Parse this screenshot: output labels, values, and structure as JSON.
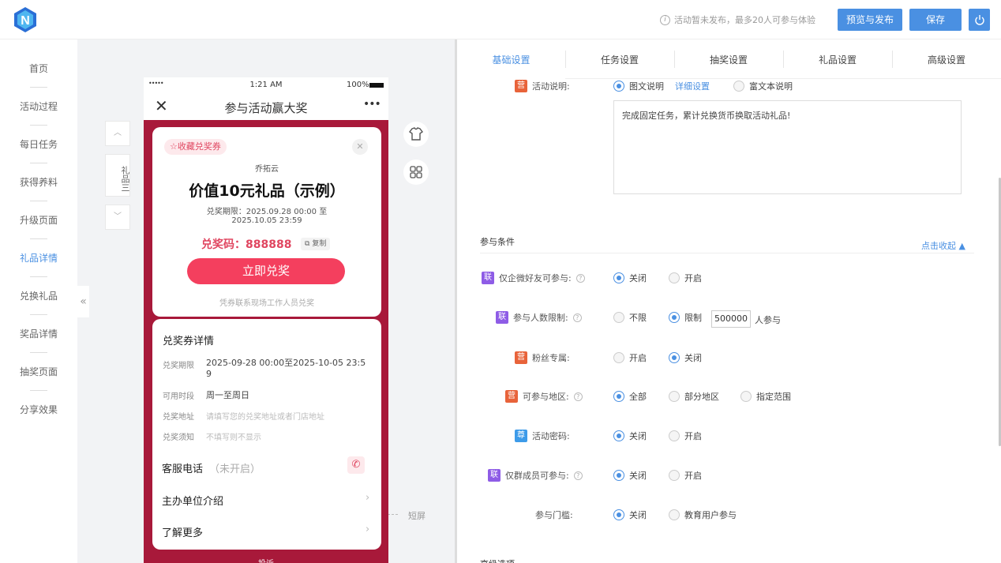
{
  "header": {
    "notice": "活动暂未发布，最多20人可参与体验",
    "preview_button": "预览与发布",
    "save_button": "保存"
  },
  "left_nav": {
    "items": [
      "首页",
      "活动过程",
      "每日任务",
      "获得养料",
      "升级页面",
      "礼品详情",
      "兑换礼品",
      "奖品详情",
      "抽奖页面",
      "分享效果"
    ],
    "active": "礼品详情"
  },
  "canvas": {
    "side_label": "礼品三",
    "short_screen": "短屏"
  },
  "phone": {
    "status_dots": "•••••",
    "status_time": "1:21 AM",
    "status_battery": "100%",
    "title": "参与活动赢大奖",
    "more": "•••",
    "voucher": {
      "collect_label": "收藏兑奖券",
      "brand": "乔拓云",
      "title": "价值10元礼品（示例）",
      "validity_line1": "兑奖期限：2025.09.28 00:00 至",
      "validity_line2": "2025.10.05 23:59",
      "code_label": "兑奖码：888888",
      "copy": "复制",
      "redeem_button": "立即兑奖",
      "hint": "凭券联系现场工作人员兑奖"
    },
    "details": {
      "title": "兑奖券详情",
      "rows": [
        {
          "key": "兑奖期限",
          "value": "2025-09-28 00:00至2025-10-05 23:59"
        },
        {
          "key": "可用时段",
          "value": "周一至周日"
        },
        {
          "key": "兑奖地址",
          "value": "请填写您的兑奖地址或者门店地址"
        },
        {
          "key": "兑奖须知",
          "value": "不填写则不显示"
        }
      ],
      "service_phone": "客服电话",
      "service_phone_state": "（未开启）",
      "organizer": "主办单位介绍",
      "learn_more": "了解更多",
      "bottom_text": "投诉"
    }
  },
  "tabs": [
    "基础设置",
    "任务设置",
    "抽奖设置",
    "礼品设置",
    "高级设置"
  ],
  "active_tab": "基础设置",
  "activity_desc": {
    "badge": "营",
    "label": "活动说明:",
    "option_graphic": "图文说明",
    "detail_link": "详细设置",
    "option_rich": "富文本说明",
    "text": "完成固定任务，累计兑换货币换取活动礼品!"
  },
  "conditions": {
    "section_title": "参与条件",
    "collapse_link": "点击收起",
    "rows": [
      {
        "badge": "联",
        "label": "仅企微好友可参与:",
        "help": "?",
        "options": [
          "关闭",
          "开启"
        ],
        "selected": 0
      },
      {
        "badge": "联",
        "label": "参与人数限制:",
        "help": "?",
        "options": [
          "不限",
          "限制"
        ],
        "selected": 1,
        "limit_value": "500000",
        "limit_suffix": "人参与"
      },
      {
        "badge": "营",
        "label": "粉丝专属:",
        "options": [
          "开启",
          "关闭"
        ],
        "selected": 1
      },
      {
        "badge": "营",
        "label": "可参与地区:",
        "help": "?",
        "options": [
          "全部",
          "部分地区",
          "指定范围"
        ],
        "selected": 0
      },
      {
        "badge": "尊",
        "label": "活动密码:",
        "options": [
          "关闭",
          "开启"
        ],
        "selected": 0
      },
      {
        "badge": "联",
        "label": "仅群成员可参与:",
        "help": "?",
        "options": [
          "关闭",
          "开启"
        ],
        "selected": 0
      },
      {
        "badge": "",
        "label": "参与门槛:",
        "options": [
          "关闭",
          "教育用户参与"
        ],
        "selected": 0
      }
    ],
    "next_section_partial": "高级选项"
  },
  "colors": {
    "accent": "#4a90e2",
    "brand_red": "#a8193a",
    "button_red": "#f43f5e"
  }
}
